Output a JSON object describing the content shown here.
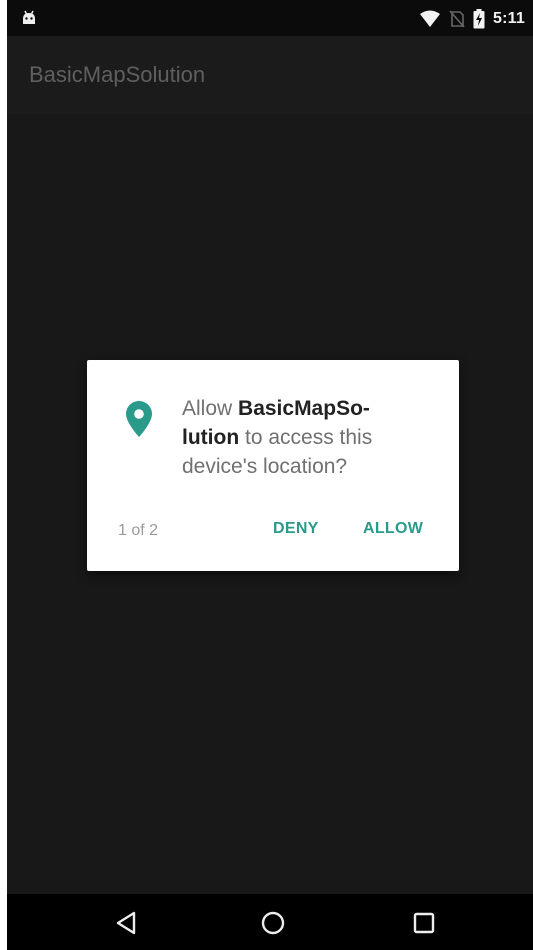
{
  "status_bar": {
    "time": "5:11",
    "left_icon": "android-notification-icon",
    "right_icons": [
      "wifi-icon",
      "no-sim-icon",
      "battery-charging-icon"
    ]
  },
  "app_bar": {
    "title": "BasicMapSolution"
  },
  "dialog": {
    "icon": "location-pin-icon",
    "message_prefix": "Allow ",
    "message_app_line1": "BasicMapSo-",
    "message_app_line2": "lution",
    "message_suffix": " to access this device's location?",
    "counter": "1 of 2",
    "deny_label": "DENY",
    "allow_label": "ALLOW"
  },
  "nav_bar": {
    "buttons": [
      "back-icon",
      "home-icon",
      "recents-icon"
    ]
  },
  "colors": {
    "accent": "#2a9a8a",
    "background": "#181818",
    "status_bar": "#0b0b0b",
    "nav_bar": "#000000"
  }
}
